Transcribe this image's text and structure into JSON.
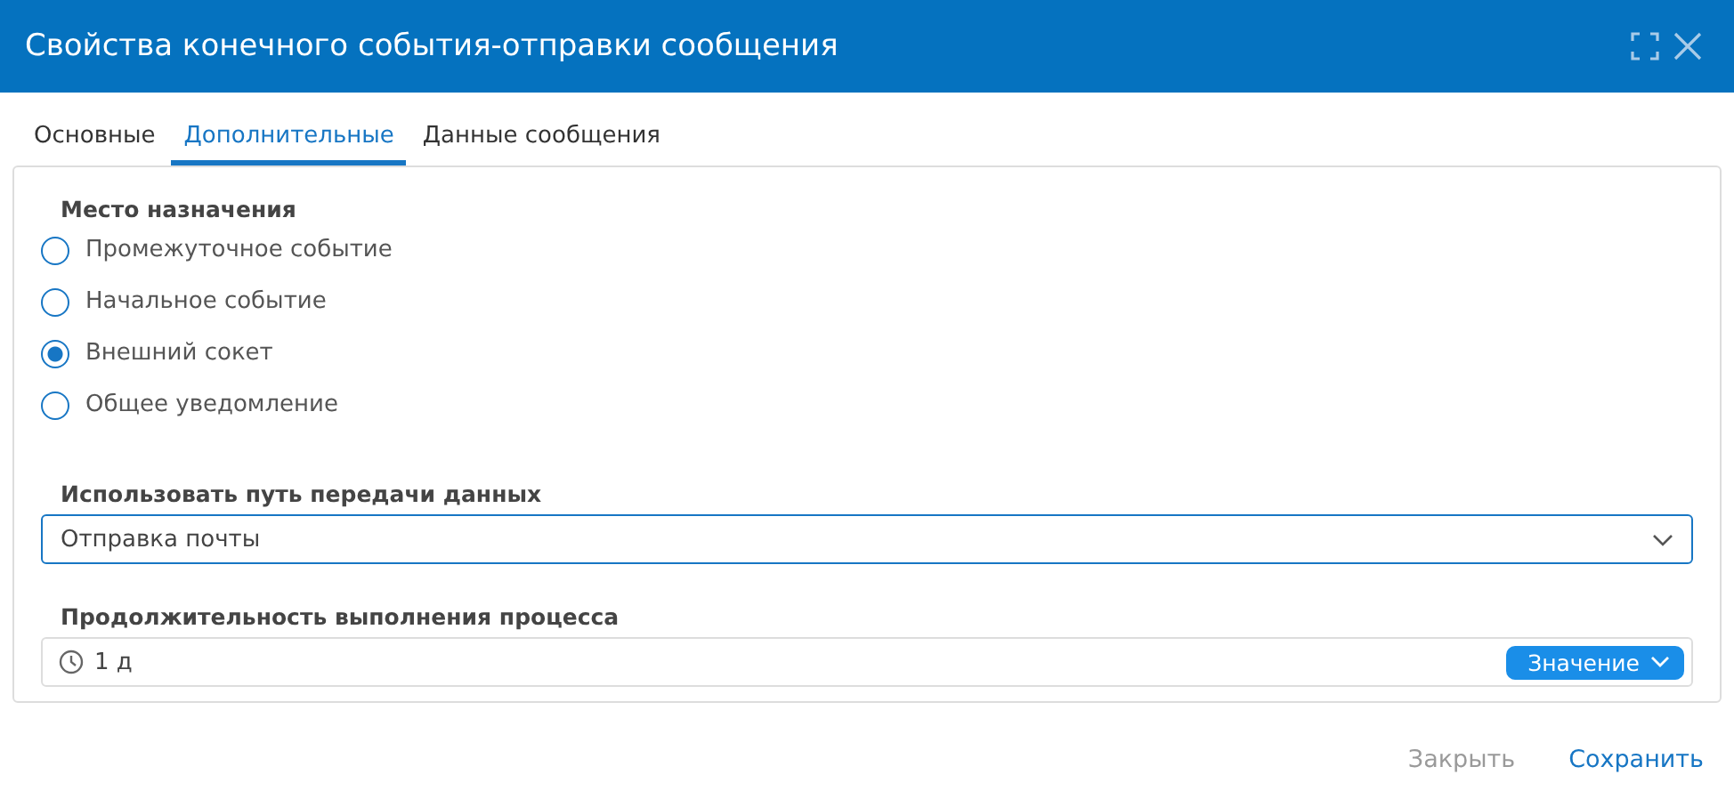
{
  "window": {
    "title": "Свойства конечного события-отправки сообщения"
  },
  "tabs": [
    {
      "label": "Основные",
      "selected": false
    },
    {
      "label": "Дополнительные",
      "selected": true
    },
    {
      "label": "Данные сообщения",
      "selected": false
    }
  ],
  "destination": {
    "label": "Место назначения",
    "options": [
      {
        "label": "Промежуточное событие",
        "selected": false
      },
      {
        "label": "Начальное событие",
        "selected": false
      },
      {
        "label": "Внешний сокет",
        "selected": true
      },
      {
        "label": "Общее уведомление",
        "selected": false
      }
    ]
  },
  "data_path": {
    "label": "Использовать путь передачи данных",
    "value": "Отправка почты"
  },
  "duration": {
    "label": "Продолжительность выполнения процесса",
    "value": "1 д",
    "mode": "Значение"
  },
  "buttons": [
    {
      "label": "Закрыть",
      "disabled": true
    },
    {
      "label": "Сохранить",
      "disabled": false
    }
  ]
}
